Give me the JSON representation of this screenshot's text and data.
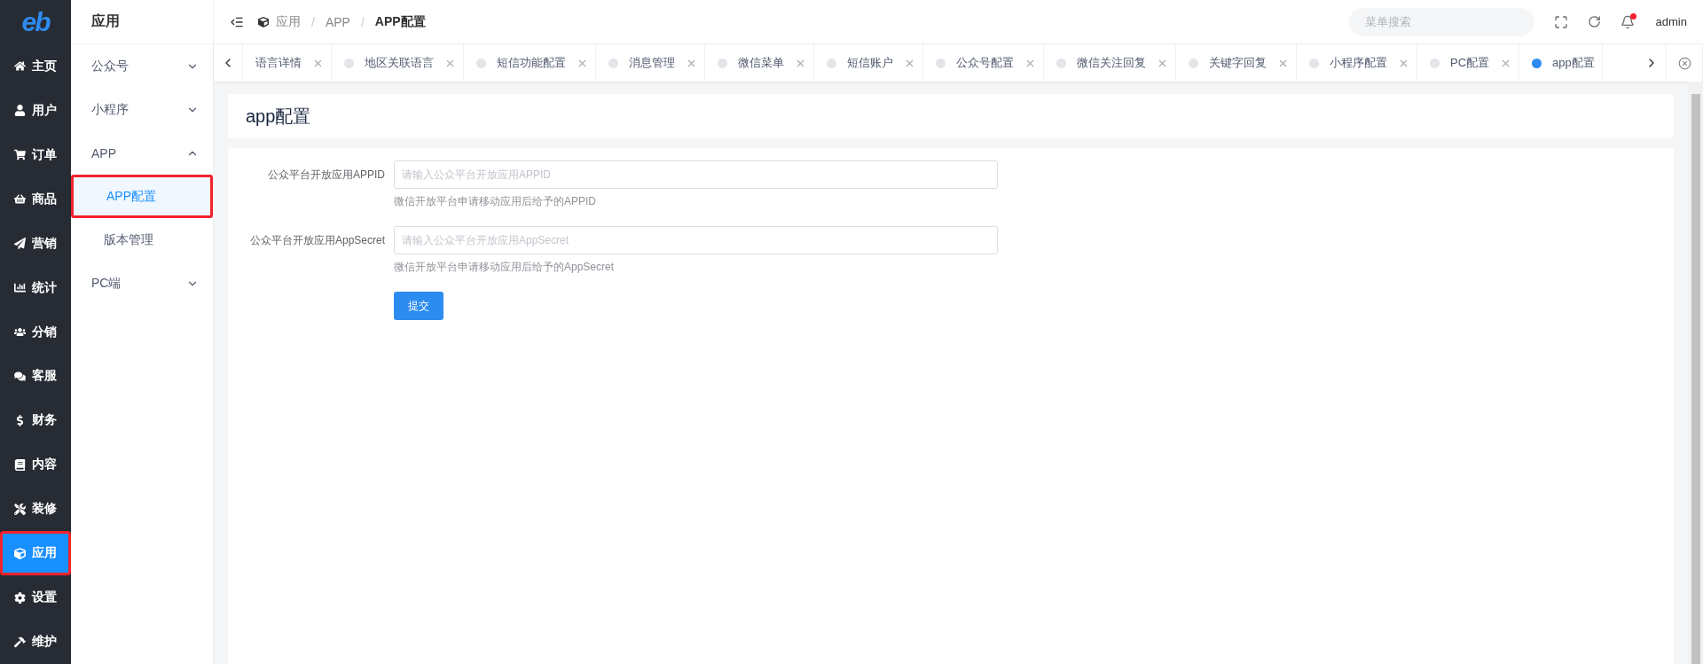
{
  "logo": {
    "text": "eb"
  },
  "nav": [
    {
      "label": "主页",
      "selected": false,
      "highlighted": false
    },
    {
      "label": "用户",
      "selected": false,
      "highlighted": false
    },
    {
      "label": "订单",
      "selected": false,
      "highlighted": false
    },
    {
      "label": "商品",
      "selected": false,
      "highlighted": false
    },
    {
      "label": "营销",
      "selected": false,
      "highlighted": false
    },
    {
      "label": "统计",
      "selected": false,
      "highlighted": false
    },
    {
      "label": "分销",
      "selected": false,
      "highlighted": false
    },
    {
      "label": "客服",
      "selected": false,
      "highlighted": false
    },
    {
      "label": "财务",
      "selected": false,
      "highlighted": false
    },
    {
      "label": "内容",
      "selected": false,
      "highlighted": false
    },
    {
      "label": "装修",
      "selected": false,
      "highlighted": false
    },
    {
      "label": "应用",
      "selected": true,
      "highlighted": true
    },
    {
      "label": "设置",
      "selected": false,
      "highlighted": false
    },
    {
      "label": "维护",
      "selected": false,
      "highlighted": false
    }
  ],
  "submenu": {
    "title": "应用",
    "items": [
      {
        "label": "公众号",
        "expanded": false
      },
      {
        "label": "小程序",
        "expanded": false
      },
      {
        "label": "APP",
        "expanded": true,
        "children": [
          {
            "label": "APP配置",
            "selected": true,
            "highlighted": true
          },
          {
            "label": "版本管理",
            "selected": false,
            "highlighted": false
          }
        ]
      },
      {
        "label": "PC端",
        "expanded": false
      }
    ]
  },
  "breadcrumb": [
    "应用",
    "APP",
    "APP配置"
  ],
  "breadcrumb_separator": "/",
  "search": {
    "placeholder": "菜单搜索"
  },
  "user": "admin",
  "tabs": [
    {
      "label": "语言详情",
      "selected": false,
      "dot": false
    },
    {
      "label": "地区关联语言",
      "selected": false,
      "dot": true
    },
    {
      "label": "短信功能配置",
      "selected": false,
      "dot": true
    },
    {
      "label": "消息管理",
      "selected": false,
      "dot": true
    },
    {
      "label": "微信菜单",
      "selected": false,
      "dot": true
    },
    {
      "label": "短信账户",
      "selected": false,
      "dot": true
    },
    {
      "label": "公众号配置",
      "selected": false,
      "dot": true
    },
    {
      "label": "微信关注回复",
      "selected": false,
      "dot": true
    },
    {
      "label": "关键字回复",
      "selected": false,
      "dot": true
    },
    {
      "label": "小程序配置",
      "selected": false,
      "dot": true
    },
    {
      "label": "PC配置",
      "selected": false,
      "dot": true
    },
    {
      "label": "app配置",
      "selected": true,
      "dot": true
    }
  ],
  "page_title": "app配置",
  "form": {
    "fields": [
      {
        "label": "公众平台开放应用APPID",
        "placeholder": "请输入公众平台开放应用APPID",
        "help": "微信开放平台申请移动应用后给予的APPID"
      },
      {
        "label": "公众平台开放应用AppSecret",
        "placeholder": "请输入公众平台开放应用AppSecret",
        "help": "微信开放平台申请移动应用后给予的AppSecret"
      }
    ],
    "submit": "提交"
  }
}
